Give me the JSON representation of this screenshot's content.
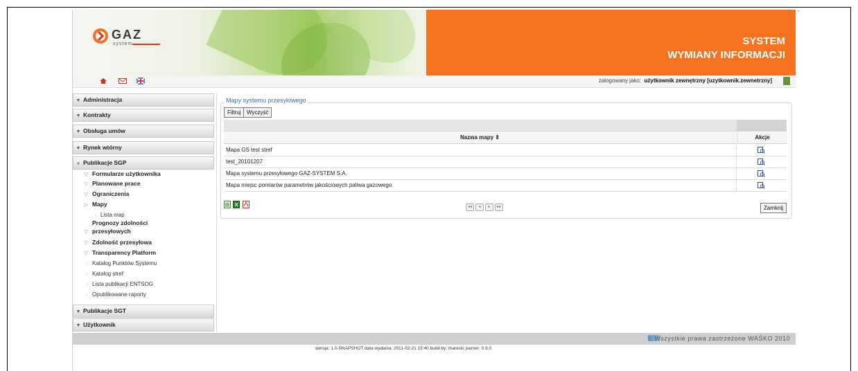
{
  "header": {
    "logo_text": "GAZ",
    "logo_sub": "system",
    "title_line1": "SYSTEM",
    "title_line2": "WYMIANY INFORMACJI"
  },
  "toolbar": {
    "icons": [
      "home-icon",
      "mail-icon",
      "uk-flag-icon"
    ],
    "login_prefix": "zalogowany jako:",
    "login_user": "użytkownik zewnętrzny [uzytkownik.zewnetrzny]"
  },
  "sidebar": {
    "sections": [
      {
        "label": "Administracja"
      },
      {
        "label": "Kontrakty"
      },
      {
        "label": "Obsługa umów"
      },
      {
        "label": "Rynek wtórny"
      },
      {
        "label": "Publikacje SGP"
      },
      {
        "label": "Publikacje SGT"
      },
      {
        "label": "Użytkownik"
      }
    ],
    "items": [
      {
        "label": "Formularze użytkownika"
      },
      {
        "label": "Planowane prace"
      },
      {
        "label": "Ograniczenia"
      },
      {
        "label": "Mapy"
      },
      {
        "label": "Lista map"
      },
      {
        "label": "Prognozy zdolności"
      },
      {
        "label": "przesyłowych"
      },
      {
        "label": "Zdolność przesyłowa"
      },
      {
        "label": "Transparency Platform"
      },
      {
        "label": "Katalog Punktów Systemu"
      },
      {
        "label": "Katalog stref"
      },
      {
        "label": "Lista publikacji ENTSOG"
      },
      {
        "label": "Opublikowane raporty"
      }
    ]
  },
  "main": {
    "panel_title": "Mapy systemu przesyłowego",
    "filter_button": "Filtruj",
    "clear_button": "Wyczyść",
    "columns": {
      "name": "Nazwa mapy ⇕",
      "actions": "Akcje"
    },
    "rows": [
      {
        "name": "Mapa GS test stref"
      },
      {
        "name": "test_20101207"
      },
      {
        "name": "Mapa systemu przesyłowego GAZ-SYSTEM S.A."
      },
      {
        "name": "Mapa miejsc pomiarów parametrów jakościowych paliwa gazowego"
      }
    ],
    "close_button": "Zamknij",
    "pager": [
      "◂◂",
      "◂",
      "▸",
      "▸▸"
    ]
  },
  "footer": {
    "copyright": "Wszystkie prawa zastrzeżone WAŚKO 2010",
    "version": "wersja: 1.0-SNAPSHOT data wydania: 2011-02-21 15:40 build-by: rkarecki jserver: 0.9.0"
  },
  "colors": {
    "orange": "#f47320",
    "link_blue": "#3a6fc4"
  }
}
